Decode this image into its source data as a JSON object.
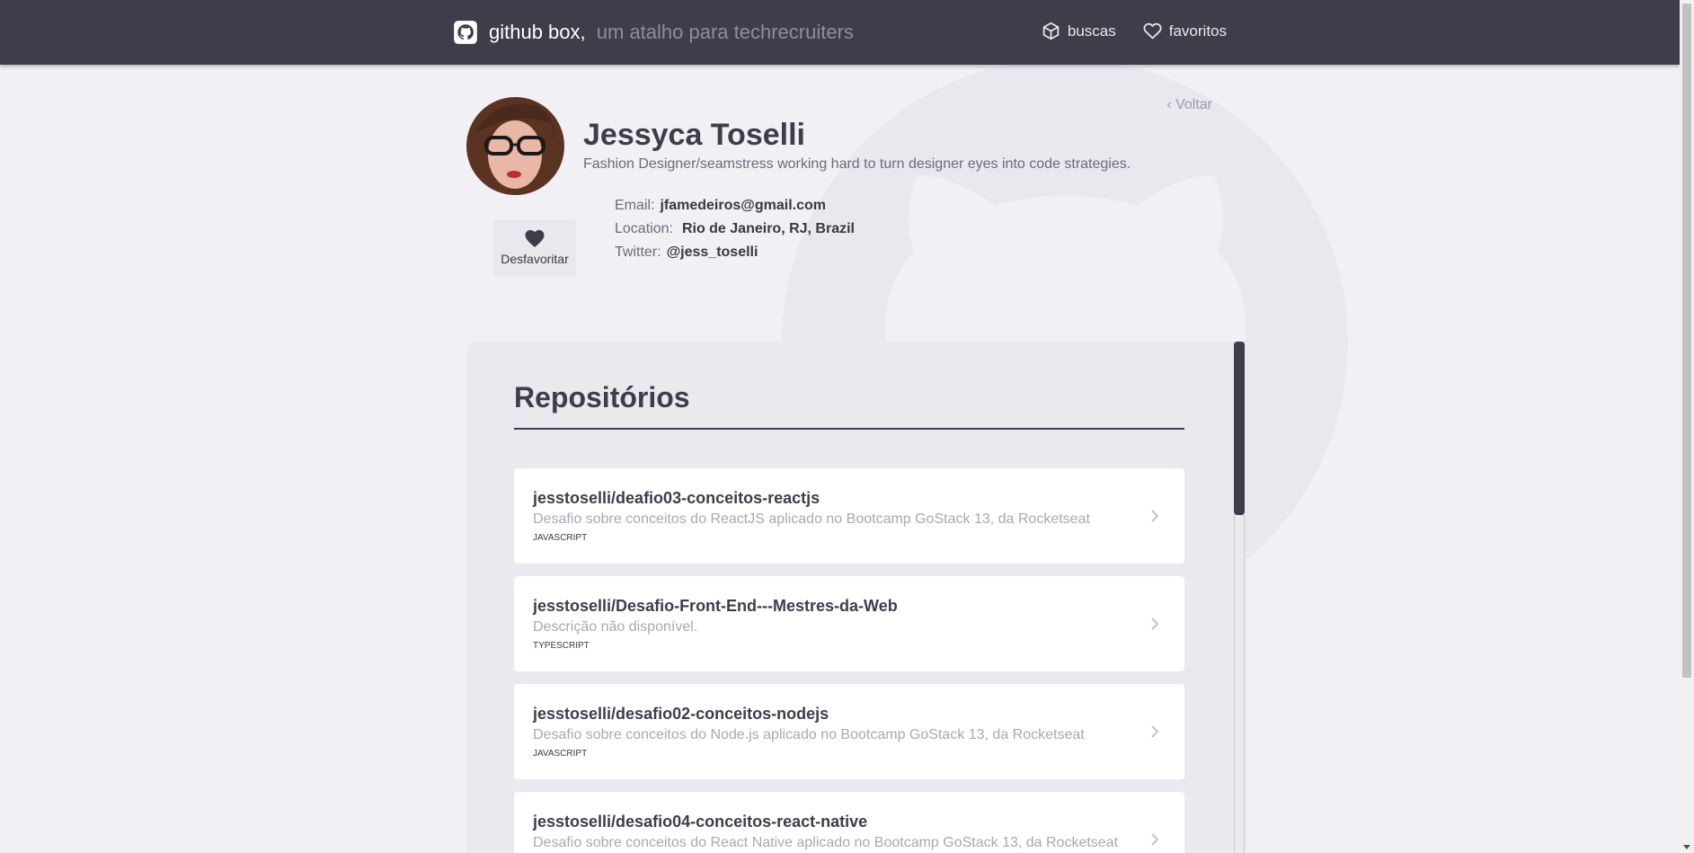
{
  "header": {
    "brand": "github box,",
    "brand_sub": "um atalho para techrecruiters",
    "nav": [
      {
        "label": "buscas",
        "icon": "box-icon"
      },
      {
        "label": "favoritos",
        "icon": "heart-outline-icon"
      }
    ]
  },
  "profile": {
    "name": "Jessyca Toselli",
    "bio": "Fashion Designer/seamstress working hard to turn designer eyes into code strategies.",
    "email_label": "Email:",
    "email": "jfamedeiros@gmail.com",
    "location_label": "Location:",
    "location": "Rio de Janeiro, RJ, Brazil",
    "twitter_label": "Twitter:",
    "twitter": "@jess_toselli",
    "fav_button": "Desfavoritar",
    "back": "‹ Voltar"
  },
  "repos": {
    "title": "Repositórios",
    "items": [
      {
        "name": "jesstoselli/deafio03-conceitos-reactjs",
        "desc": "Desafio sobre conceitos do ReactJS aplicado no Bootcamp GoStack 13, da Rocketseat",
        "lang": "JAVASCRIPT"
      },
      {
        "name": "jesstoselli/Desafio-Front-End---Mestres-da-Web",
        "desc": "Descrição não disponível.",
        "lang": "TYPESCRIPT"
      },
      {
        "name": "jesstoselli/desafio02-conceitos-nodejs",
        "desc": "Desafio sobre conceitos do Node.js aplicado no Bootcamp GoStack 13, da Rocketseat",
        "lang": "JAVASCRIPT"
      },
      {
        "name": "jesstoselli/desafio04-conceitos-react-native",
        "desc": "Desafio sobre conceitos do React Native aplicado no Bootcamp GoStack 13, da Rocketseat",
        "lang": ""
      }
    ]
  },
  "colors": {
    "header_bg": "#3e3d49",
    "page_bg": "#f0f0f5",
    "panel_bg": "#e9e9ef",
    "accent": "#3e3d49"
  }
}
